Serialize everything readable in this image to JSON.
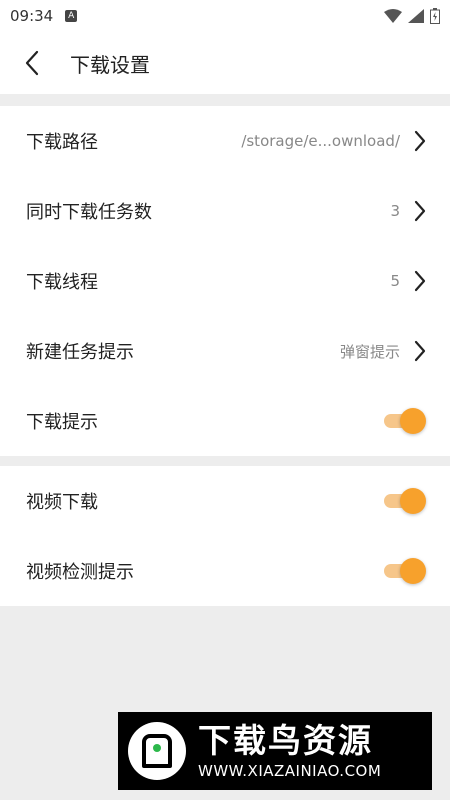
{
  "status_bar": {
    "time": "09:34",
    "app_icon_letter": "A"
  },
  "header": {
    "title": "下载设置"
  },
  "settings_group_1": [
    {
      "label": "下载路径",
      "value": "/storage/e...ownload/",
      "control": "chevron"
    },
    {
      "label": "同时下载任务数",
      "value": "3",
      "control": "chevron"
    },
    {
      "label": "下载线程",
      "value": "5",
      "control": "chevron"
    },
    {
      "label": "新建任务提示",
      "value": "弹窗提示",
      "control": "chevron"
    },
    {
      "label": "下载提示",
      "control": "switch",
      "on": true
    }
  ],
  "settings_group_2": [
    {
      "label": "视频下载",
      "control": "switch",
      "on": true
    },
    {
      "label": "视频检测提示",
      "control": "switch",
      "on": true
    }
  ],
  "watermark": {
    "title": "下载鸟资源",
    "url": "WWW.XIAZAINIAO.COM"
  },
  "colors": {
    "accent": "#f7a12c",
    "accent_track": "#f6c68a",
    "background": "#ededed",
    "surface": "#ffffff"
  }
}
